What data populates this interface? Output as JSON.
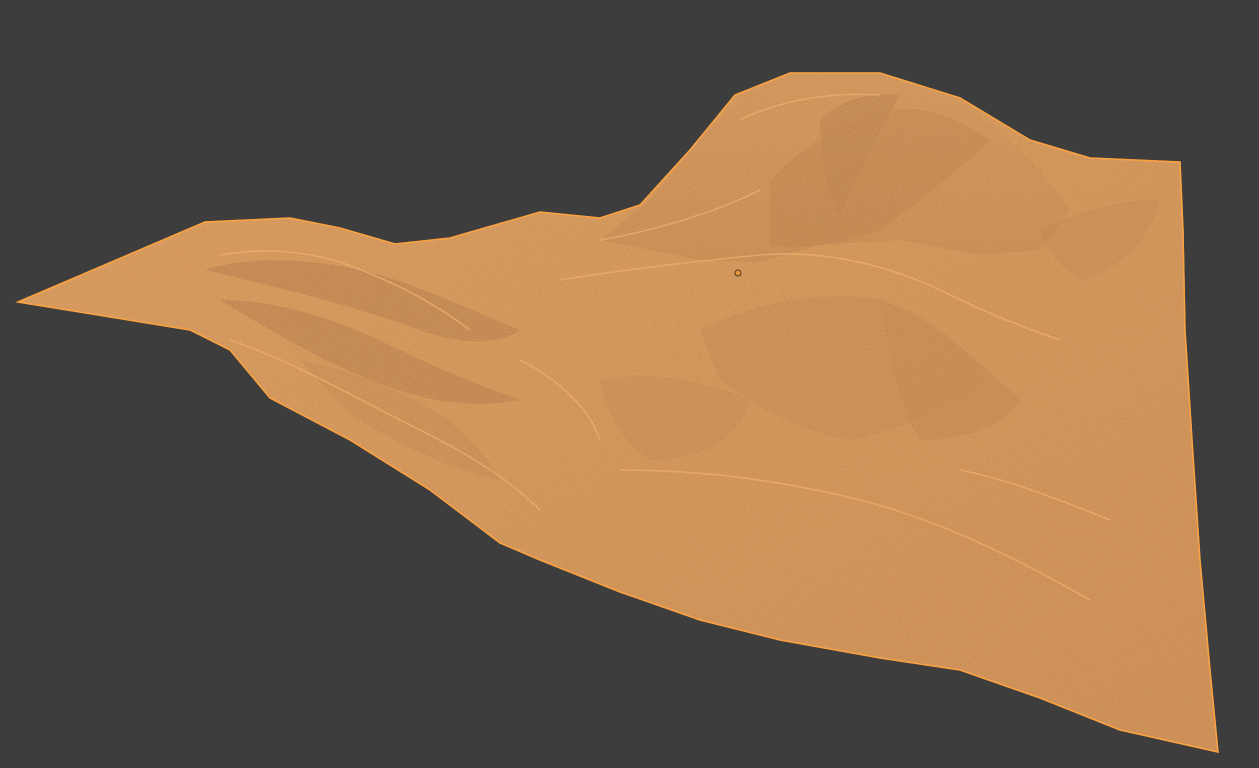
{
  "viewport": {
    "background": "#3d3d3d",
    "mode": "3d-viewport",
    "shading": "solid"
  },
  "mesh": {
    "kind": "terrain",
    "selected": true,
    "selection_outline_color": "#ffa037",
    "base_color": "#c6864a",
    "highlight_color": "#e39a55",
    "shadow_color": "#a16a3b"
  },
  "object_origin": {
    "color": "#e59a37"
  }
}
